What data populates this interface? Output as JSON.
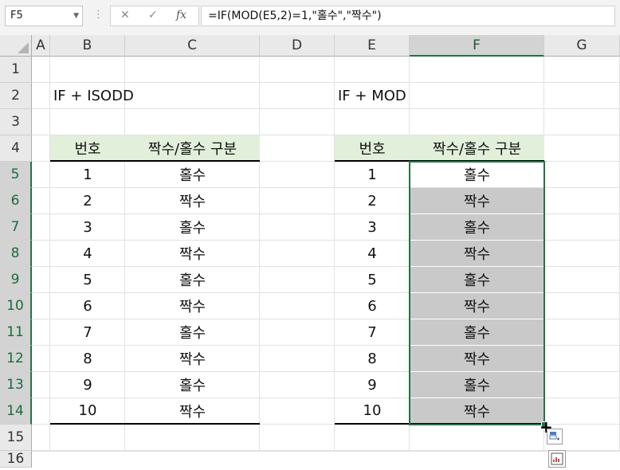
{
  "formula_bar": {
    "name_box": "F5",
    "cancel_icon": "✕",
    "enter_icon": "✓",
    "fx_label": "fx",
    "formula": "=IF(MOD(E5,2)=1,\"홀수\",\"짝수\")"
  },
  "columns": [
    "A",
    "B",
    "C",
    "D",
    "E",
    "F",
    "G"
  ],
  "rows": [
    "1",
    "2",
    "3",
    "4",
    "5",
    "6",
    "7",
    "8",
    "9",
    "10",
    "11",
    "12",
    "13",
    "14",
    "15",
    "16"
  ],
  "left_table": {
    "title": "IF +  ISODD",
    "headers": [
      "번호",
      "짝수/홀수 구분"
    ],
    "data": [
      [
        "1",
        "홀수"
      ],
      [
        "2",
        "짝수"
      ],
      [
        "3",
        "홀수"
      ],
      [
        "4",
        "짝수"
      ],
      [
        "5",
        "홀수"
      ],
      [
        "6",
        "짝수"
      ],
      [
        "7",
        "홀수"
      ],
      [
        "8",
        "짝수"
      ],
      [
        "9",
        "홀수"
      ],
      [
        "10",
        "짝수"
      ]
    ]
  },
  "right_table": {
    "title": "IF + MOD",
    "headers": [
      "번호",
      "짝수/홀수 구분"
    ],
    "data": [
      [
        "1",
        "홀수"
      ],
      [
        "2",
        "짝수"
      ],
      [
        "3",
        "홀수"
      ],
      [
        "4",
        "짝수"
      ],
      [
        "5",
        "홀수"
      ],
      [
        "6",
        "짝수"
      ],
      [
        "7",
        "홀수"
      ],
      [
        "8",
        "짝수"
      ],
      [
        "9",
        "홀수"
      ],
      [
        "10",
        "짝수"
      ]
    ]
  },
  "selection": {
    "active_cell": "F5",
    "range": "F5:F14"
  },
  "colors": {
    "accent": "#217346",
    "header_fill": "#e2efda",
    "selection_fill": "#c9c9c9"
  },
  "icons": {
    "fill_handle": "plus-cursor-icon",
    "autofill_options": "auto-fill-options-icon",
    "quick_analysis": "quick-analysis-icon"
  }
}
